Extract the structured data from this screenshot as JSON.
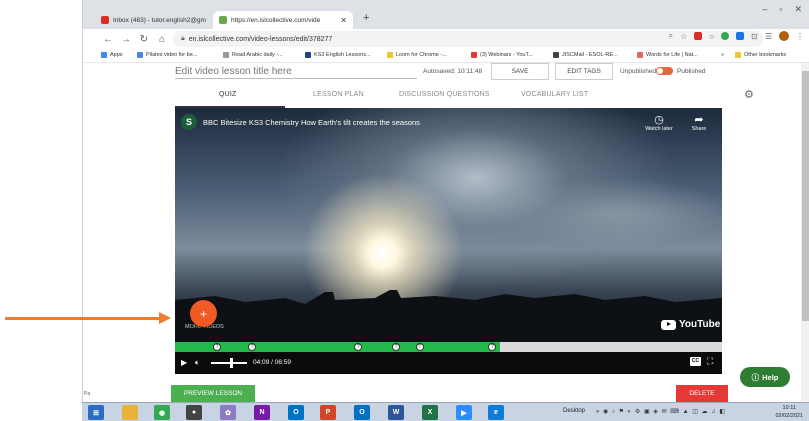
{
  "browser": {
    "tabs": [
      {
        "label": "Inbox (483) - tutor.english2@gm",
        "color": "#d93025"
      },
      {
        "label": "https://en.islcollective.com/vide",
        "color": "#6aa84f"
      }
    ],
    "new_tab": "+",
    "window_controls": [
      "–",
      "▫",
      "✕"
    ],
    "url": "en.islcollective.com/video-lessons/edit/378277",
    "bookmarks": [
      {
        "label": "Apps",
        "color": "#4285f4"
      },
      {
        "label": "Pilates video for be...",
        "color": "#4a86e8"
      },
      {
        "label": "Read Arabic daily -...",
        "color": "#999999"
      },
      {
        "label": "KS3 English Lessons...",
        "color": "#1c4587"
      },
      {
        "label": "Loom for Chrome -...",
        "color": "#f1c232"
      },
      {
        "label": "(3) Webinars - YouT...",
        "color": "#e53935"
      },
      {
        "label": "JISCMail - ESOL-RE...",
        "color": "#444444"
      },
      {
        "label": "Words for Life | Nat...",
        "color": "#e06666"
      }
    ],
    "bookmarks_more": "»",
    "other_bookmarks": "Other bookmarks"
  },
  "editor": {
    "title_placeholder": "Edit video lesson title here",
    "autosaved": "Autosaved: 10:11:48",
    "save_label": "SAVE",
    "edit_tags_label": "EDIT TAGS",
    "unpublished": "Unpublished",
    "published": "Published",
    "tabs": [
      "QUIZ",
      "LESSON PLAN",
      "DISCUSSION QUESTIONS",
      "VOCABULARY LIST"
    ],
    "active_tab": "QUIZ"
  },
  "video": {
    "channel_initial": "S",
    "title": "BBC Bitesize KS3 Chemistry How Earth's tilt creates the seasons",
    "watch_later": "Watch later",
    "share": "Share",
    "more_videos": "MORE VIDEOS",
    "youtube": "YouTube",
    "current_time": "04:09",
    "duration": "06:59",
    "time_display": "04:09 / 06:59",
    "progress_fraction": 0.594,
    "quiz_markers": [
      "?",
      "?",
      "?",
      "?",
      "?",
      "?"
    ],
    "marker_fractions": [
      0.077,
      0.141,
      0.335,
      0.404,
      0.447,
      0.58
    ],
    "cc": "CC"
  },
  "actions": {
    "preview_label": "PREVIEW LESSON",
    "delete_label": "DELETE",
    "help_label": "Help",
    "add_label": "+"
  },
  "taskbar": {
    "desktop": "Desktop",
    "time": "10:11",
    "date": "02/02/2021",
    "apps": [
      {
        "name": "start",
        "color": "#2b6cc4",
        "glyph": "⊞"
      },
      {
        "name": "explorer",
        "color": "#e8b339",
        "glyph": ""
      },
      {
        "name": "chrome",
        "color": "#34a853",
        "glyph": "◉"
      },
      {
        "name": "camera",
        "color": "#444444",
        "glyph": "●"
      },
      {
        "name": "paint",
        "color": "#8e7cc3",
        "glyph": "✿"
      },
      {
        "name": "onenote",
        "color": "#7719aa",
        "glyph": "N"
      },
      {
        "name": "outlook",
        "color": "#0072c6",
        "glyph": "O"
      },
      {
        "name": "powerpoint",
        "color": "#d24726",
        "glyph": "P"
      },
      {
        "name": "outlook2",
        "color": "#0072c6",
        "glyph": "O"
      },
      {
        "name": "word",
        "color": "#2b579a",
        "glyph": "W"
      },
      {
        "name": "excel",
        "color": "#217346",
        "glyph": "X"
      },
      {
        "name": "zoom",
        "color": "#2d8cff",
        "glyph": "▶"
      },
      {
        "name": "edge",
        "color": "#0f7bd8",
        "glyph": "e"
      }
    ]
  },
  "status_hint": "Pa"
}
